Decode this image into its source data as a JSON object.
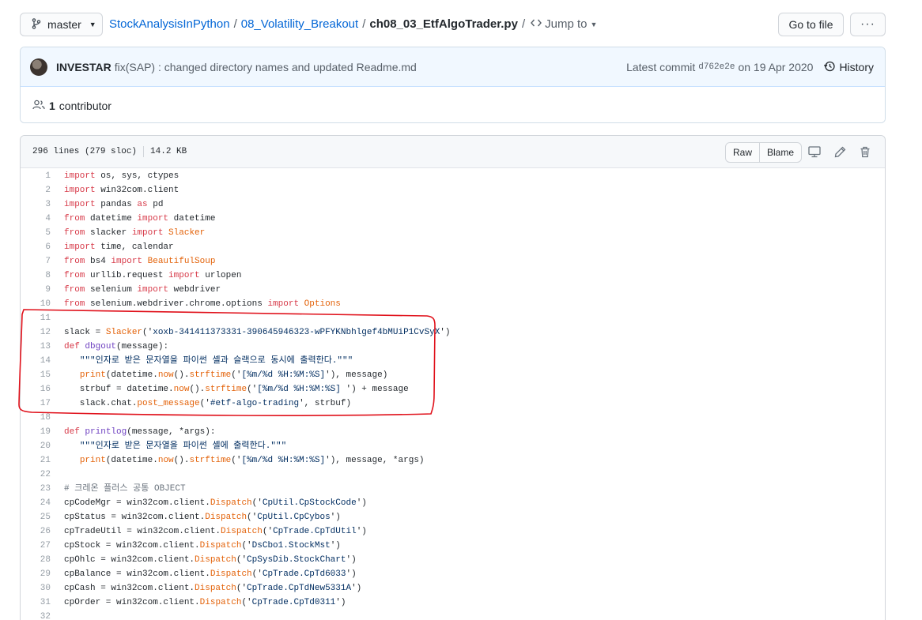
{
  "topbar": {
    "branch": "master",
    "repo": "StockAnalysisInPython",
    "folder": "08_Volatility_Breakout",
    "file": "ch08_03_EtfAlgoTrader.py",
    "sep": "/",
    "jump_to": "Jump to",
    "goto_file": "Go to file",
    "more": "···"
  },
  "commit": {
    "author": "INVESTAR",
    "message": "fix(SAP) : changed directory names and updated Readme.md",
    "latest_label": "Latest commit",
    "sha": "d762e2e",
    "date": "on 19 Apr 2020",
    "history": "History",
    "contributors_count": "1",
    "contributors_label": "contributor"
  },
  "file": {
    "lines": "296 lines (279 sloc)",
    "size": "14.2 KB",
    "raw": "Raw",
    "blame": "Blame"
  },
  "code_lines": [
    [
      [
        "k",
        "import"
      ],
      [
        "",
        "  os, sys, ctypes"
      ]
    ],
    [
      [
        "k",
        "import"
      ],
      [
        "",
        "  win32com.client"
      ]
    ],
    [
      [
        "k",
        "import"
      ],
      [
        "",
        "  pandas "
      ],
      [
        "k",
        "as"
      ],
      [
        "",
        "  pd"
      ]
    ],
    [
      [
        "k",
        "from"
      ],
      [
        "",
        "  datetime "
      ],
      [
        "k",
        "import"
      ],
      [
        "",
        "  datetime"
      ]
    ],
    [
      [
        "k",
        "from"
      ],
      [
        "",
        "  slacker "
      ],
      [
        "k",
        "import"
      ],
      [
        "cl",
        "  Slacker"
      ]
    ],
    [
      [
        "k",
        "import"
      ],
      [
        "",
        "  time, calendar"
      ]
    ],
    [
      [
        "k",
        "from"
      ],
      [
        "",
        "  bs4 "
      ],
      [
        "k",
        "import"
      ],
      [
        "cl",
        "  BeautifulSoup"
      ]
    ],
    [
      [
        "k",
        "from"
      ],
      [
        "",
        "  urllib.request "
      ],
      [
        "k",
        "import"
      ],
      [
        "",
        "  urlopen"
      ]
    ],
    [
      [
        "k",
        "from"
      ],
      [
        "",
        "  selenium "
      ],
      [
        "k",
        "import"
      ],
      [
        "",
        "  webdriver"
      ]
    ],
    [
      [
        "k",
        "from"
      ],
      [
        "",
        "  selenium.webdriver.chrome.options "
      ],
      [
        "k",
        "import"
      ],
      [
        "cl",
        "  Options"
      ]
    ],
    [],
    [
      [
        "",
        "slack = "
      ],
      [
        "cl",
        "Slacker"
      ],
      [
        "",
        "('"
      ],
      [
        "s",
        "xoxb-341411373331-390645946323-wPFYKNbhlgef4bMUiP1CvSyX"
      ],
      [
        "",
        "')"
      ]
    ],
    [
      [
        "k",
        "def"
      ],
      [
        "f",
        "  dbgout"
      ],
      [
        "",
        "(message):"
      ]
    ],
    [
      [
        "",
        "    "
      ],
      [
        "s",
        "\"\"\"인자로 받은 문자열을 파이썬 셸과 슬랙으로 동시에 출력한다.\"\"\""
      ]
    ],
    [
      [
        "",
        "    "
      ],
      [
        "cl",
        "print"
      ],
      [
        "",
        "(datetime."
      ],
      [
        "cl",
        "now"
      ],
      [
        "",
        "()."
      ],
      [
        "cl",
        "strftime"
      ],
      [
        "",
        "('"
      ],
      [
        "s",
        "[%m/%d %H:%M:%S]"
      ],
      [
        "",
        "'), message)"
      ]
    ],
    [
      [
        "",
        "    strbuf = datetime."
      ],
      [
        "cl",
        "now"
      ],
      [
        "",
        "()."
      ],
      [
        "cl",
        "strftime"
      ],
      [
        "",
        "('"
      ],
      [
        "s",
        "[%m/%d %H:%M:%S] "
      ],
      [
        "",
        "') + message"
      ]
    ],
    [
      [
        "",
        "    slack.chat."
      ],
      [
        "cl",
        "post_message"
      ],
      [
        "",
        "('"
      ],
      [
        "s",
        "#etf-algo-trading"
      ],
      [
        "",
        "', strbuf)"
      ]
    ],
    [],
    [
      [
        "k",
        "def"
      ],
      [
        "f",
        "  printlog"
      ],
      [
        "",
        "(message, *args):"
      ]
    ],
    [
      [
        "",
        "    "
      ],
      [
        "s",
        "\"\"\"인자로 받은 문자열을 파이썬 셸에 출력한다.\"\"\""
      ]
    ],
    [
      [
        "",
        "    "
      ],
      [
        "cl",
        "print"
      ],
      [
        "",
        "(datetime."
      ],
      [
        "cl",
        "now"
      ],
      [
        "",
        "()."
      ],
      [
        "cl",
        "strftime"
      ],
      [
        "",
        "('"
      ],
      [
        "s",
        "[%m/%d %H:%M:%S]"
      ],
      [
        "",
        "'), message, *args)"
      ]
    ],
    [],
    [
      [
        "c",
        "# 크레온 플러스 공통 OBJECT"
      ]
    ],
    [
      [
        "",
        "cpCodeMgr = win32com.client."
      ],
      [
        "cl",
        "Dispatch"
      ],
      [
        "",
        "('"
      ],
      [
        "s",
        "CpUtil.CpStockCode"
      ],
      [
        "",
        "')"
      ]
    ],
    [
      [
        "",
        "cpStatus = win32com.client."
      ],
      [
        "cl",
        "Dispatch"
      ],
      [
        "",
        "('"
      ],
      [
        "s",
        "CpUtil.CpCybos"
      ],
      [
        "",
        "')"
      ]
    ],
    [
      [
        "",
        "cpTradeUtil = win32com.client."
      ],
      [
        "cl",
        "Dispatch"
      ],
      [
        "",
        "('"
      ],
      [
        "s",
        "CpTrade.CpTdUtil"
      ],
      [
        "",
        "')"
      ]
    ],
    [
      [
        "",
        "cpStock = win32com.client."
      ],
      [
        "cl",
        "Dispatch"
      ],
      [
        "",
        "('"
      ],
      [
        "s",
        "DsCbo1.StockMst"
      ],
      [
        "",
        "')"
      ]
    ],
    [
      [
        "",
        "cpOhlc = win32com.client."
      ],
      [
        "cl",
        "Dispatch"
      ],
      [
        "",
        "('"
      ],
      [
        "s",
        "CpSysDib.StockChart"
      ],
      [
        "",
        "')"
      ]
    ],
    [
      [
        "",
        "cpBalance = win32com.client."
      ],
      [
        "cl",
        "Dispatch"
      ],
      [
        "",
        "('"
      ],
      [
        "s",
        "CpTrade.CpTd6033"
      ],
      [
        "",
        "')"
      ]
    ],
    [
      [
        "",
        "cpCash = win32com.client."
      ],
      [
        "cl",
        "Dispatch"
      ],
      [
        "",
        "('"
      ],
      [
        "s",
        "CpTrade.CpTdNew5331A"
      ],
      [
        "",
        "')"
      ]
    ],
    [
      [
        "",
        "cpOrder = win32com.client."
      ],
      [
        "cl",
        "Dispatch"
      ],
      [
        "",
        "('"
      ],
      [
        "s",
        "CpTrade.CpTd0311"
      ],
      [
        "",
        "')"
      ]
    ],
    []
  ],
  "colors": {
    "link": "#0366d6",
    "keyword": "#d73a49",
    "function": "#6f42c1",
    "string": "#032f62",
    "builtin": "#e36209",
    "annotation": "#e0101a"
  },
  "icons": [
    "git-branch-icon",
    "code-icon",
    "history-icon",
    "people-icon",
    "desktop-icon",
    "pencil-icon",
    "trash-icon"
  ]
}
